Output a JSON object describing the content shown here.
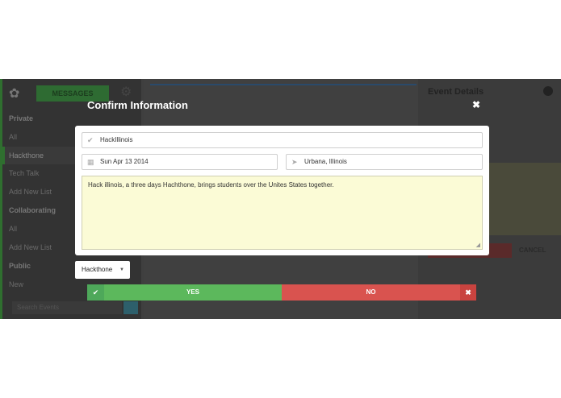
{
  "background": {
    "sidebar": {
      "messages_label": "MESSAGES",
      "private_heading": "Private",
      "items_private": [
        "All",
        "Hackthone",
        "Tech Talk",
        "Add New List"
      ],
      "collaborating_heading": "Collaborating",
      "items_collab": [
        "All",
        "Add New List"
      ],
      "public_heading": "Public",
      "items_public": [
        "New"
      ],
      "search_placeholder": "Search Events"
    },
    "right_panel": {
      "title": "Event Details",
      "cancel_label": "CANCEL"
    }
  },
  "modal": {
    "title": "Confirm Information",
    "close_icon": "×",
    "event_name": "HackIllinois",
    "date": "Sun Apr 13 2014",
    "location": "Urbana, Illinois",
    "description": "Hack illinois, a three days Hachthone, brings students over the Unites States  together.",
    "list_select": "Hackthone",
    "yes_label": "YES",
    "no_label": "NO"
  },
  "icons": {
    "check": "✔",
    "calendar": "▦",
    "location": "➤",
    "caret": "▼",
    "close": "✖"
  },
  "colors": {
    "yes": "#5cb85c",
    "no": "#d9534f",
    "description_bg": "#fbfbd6",
    "overlay": "#3f3f3f"
  }
}
